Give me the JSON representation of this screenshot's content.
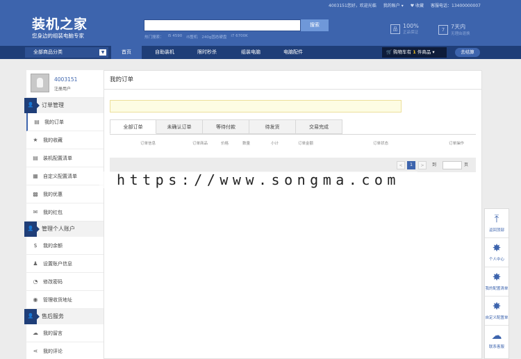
{
  "header": {
    "topbar": {
      "greeting": "4003151您好，欢迎光临",
      "my_account": "我的账户 ▾",
      "favorite": "♥ 收藏",
      "hotline": "客服电话：13400000007"
    },
    "logo": "装机之家",
    "slogan": "您身边的组装电脑专家",
    "search": {
      "value": "",
      "button": "搜索"
    },
    "hot_keywords": [
      "热门搜索：",
      "i5 4590",
      "i5整机",
      "240g固态硬盘",
      "i7 6700K"
    ],
    "promises": [
      {
        "icon": "品",
        "title": "100%",
        "subtitle": "正品保证"
      },
      {
        "icon": "7",
        "title": "7天内",
        "subtitle": "无理由退换"
      }
    ]
  },
  "nav": {
    "all_categories": "全部商品分类",
    "items": [
      "首页",
      "自助装机",
      "限时秒杀",
      "组装电脑",
      "电脑配件"
    ],
    "cart": {
      "prefix": "购物车有",
      "count": "1",
      "suffix": "件商品 ▾"
    },
    "checkout": "去结算"
  },
  "sidebar": {
    "user_id": "4003151",
    "user_role": "注册用户",
    "sections": [
      {
        "title": "订单管理",
        "items": [
          "我的订单",
          "我的收藏",
          "装机配置清单",
          "自定义配置清单",
          "我的优惠",
          "我的红包"
        ]
      },
      {
        "title": "管理个人账户",
        "items": [
          "我的余额",
          "设置账户信息",
          "修改密码",
          "管理收货地址"
        ]
      },
      {
        "title": "售后服务",
        "items": [
          "我的留言",
          "我的评论"
        ]
      }
    ]
  },
  "main": {
    "title": "我的订单",
    "tabs": [
      "全部订单",
      "未确认订单",
      "等待付款",
      "待发货",
      "交易完成"
    ],
    "columns": [
      "订单信息",
      "订单商品",
      "价格",
      "数量",
      "小计",
      "订单金额",
      "订单状态",
      "订单操作"
    ],
    "pager": {
      "prev": "<",
      "current": "1",
      "next": ">",
      "goto_prefix": "到",
      "goto_suffix": "页"
    }
  },
  "watermark": "https://www.songma.com",
  "floatbar": [
    "返回顶部",
    "个人中心",
    "我的配置清单",
    "自定义配置单",
    "联系客服"
  ]
}
